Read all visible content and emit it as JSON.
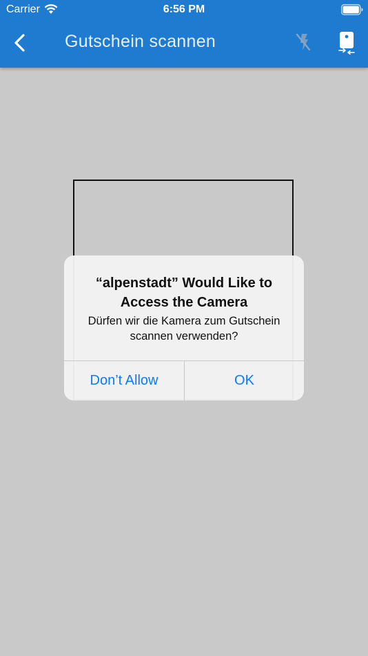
{
  "status_bar": {
    "carrier": "Carrier",
    "time": "6:56 PM"
  },
  "app_bar": {
    "title": "Gutschein scannen",
    "background_color": "#1e7bd0",
    "back_icon": "chevron-left-icon",
    "flash_icon": "flash-off-icon",
    "camera_switch_icon": "camera-switch-icon"
  },
  "alert": {
    "title": "“alpenstadt” Would Like to Access the Camera",
    "message": "Dürfen wir die Kamera zum Gutschein scannen verwenden?",
    "deny_label": "Don’t Allow",
    "ok_label": "OK",
    "button_color": "#0a7aff"
  },
  "camera_view": {
    "background_color": "#c9c9c9"
  }
}
